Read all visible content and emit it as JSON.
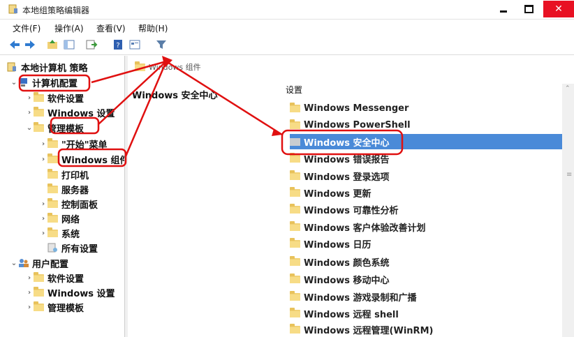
{
  "window": {
    "title": "本地组策略编辑器"
  },
  "menu": [
    "文件(F)",
    "操作(A)",
    "查看(V)",
    "帮助(H)"
  ],
  "tree": {
    "root": "本地计算机 策略",
    "computer_config": "计算机配置",
    "software_settings": "软件设置",
    "windows_settings": "Windows 设置",
    "admin_templates": "管理模板",
    "start_menu": "\"开始\"菜单",
    "windows_components": "Windows 组件",
    "printers": "打印机",
    "server": "服务器",
    "control_panel": "控制面板",
    "network": "网络",
    "system": "系统",
    "all_settings": "所有设置",
    "user_config": "用户配置",
    "user_software_settings": "软件设置",
    "user_windows_settings": "Windows 设置",
    "user_admin_templates": "管理模板"
  },
  "breadcrumb": "Windows 组件",
  "detail_title": "Windows 安全中心",
  "list_header": "设置",
  "list_items": [
    "Windows Messenger",
    "Windows PowerShell",
    "Windows 安全中心",
    "Windows 错误报告",
    "Windows 登录选项",
    "Windows 更新",
    "Windows 可靠性分析",
    "Windows 客户体验改善计划",
    "Windows 日历",
    "Windows 颜色系统",
    "Windows 移动中心",
    "Windows 游戏录制和广播",
    "Windows 远程 shell",
    "Windows 远程管理(WinRM)"
  ],
  "colors": {
    "selection": "#4a8ad8",
    "annotation": "#e01010",
    "close_button": "#e81123",
    "folder": "#f1d175"
  }
}
